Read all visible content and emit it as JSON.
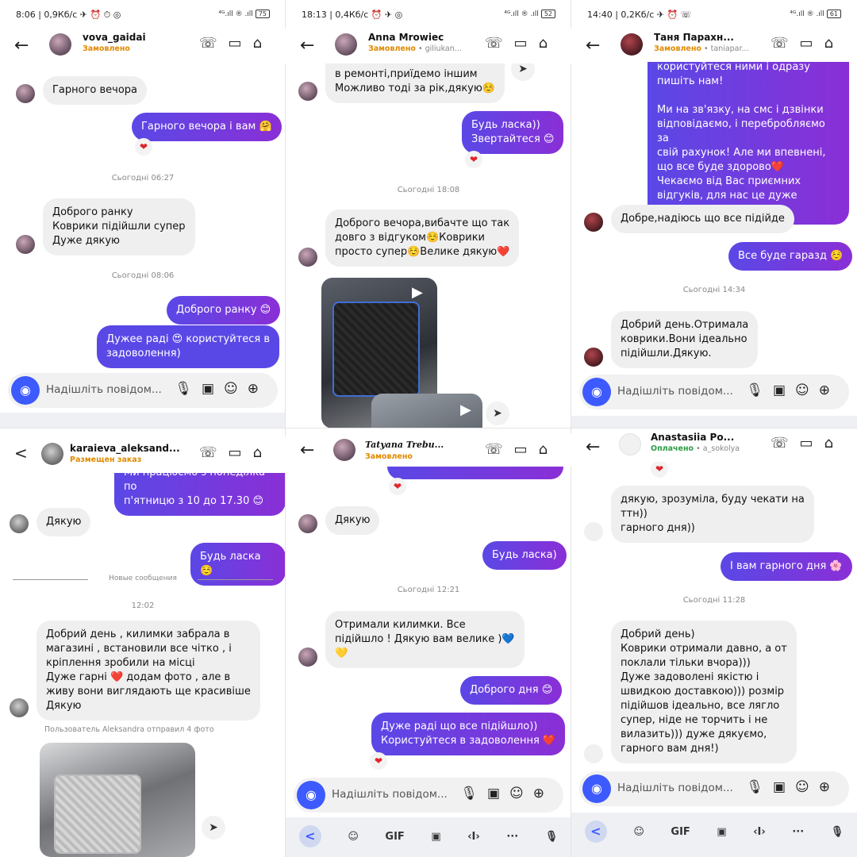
{
  "p0": {
    "status": {
      "left": "8:06 | 0,9Кб/с ✈ ⏰ ⏱ ◎",
      "right": "⁴ᴳ.ıll ® .ıll",
      "battery": "75"
    },
    "name": "vova_gaidai",
    "status_label": "Замовлено",
    "sub": "",
    "messages": [
      {
        "text": "Гарного вечора",
        "dir": "in"
      },
      {
        "text": "Гарного вечора і вам 🤗",
        "dir": "out"
      },
      {
        "text": "Доброго ранку\nКоврики підійшли супер\nДуже дякую",
        "dir": "in"
      },
      {
        "text": "Доброго ранку 😊",
        "dir": "out"
      },
      {
        "text": "Дужее раді 😍 користуйтеся в\nзадоволення)",
        "dir": "out"
      }
    ],
    "times": [
      "Сьогодні 06:27",
      "Сьогодні 08:06"
    ],
    "placeholder": "Надішліть повідом..."
  },
  "p1": {
    "status": {
      "left": "18:13 | 0,4Кб/с ⏰ ✈ ◎",
      "right": "⁴ᴳ.ıll ® .ıll",
      "battery": "52"
    },
    "name": "Anna Mrowiec",
    "status_label": "Замовлено",
    "sub": " • giliukan...",
    "messages": [
      {
        "text": "в ремонті,приїдемо іншим\nМожливо тоді за рік,дякую☺️",
        "dir": "in"
      },
      {
        "text": "Будь ласка))\nЗвертайтеся 😊",
        "dir": "out"
      },
      {
        "text": "Доброго вечора,вибачте що так\nдовго з відгуком☺️Коврики\nпросто супер☺️Велике дякую❤️",
        "dir": "in"
      }
    ],
    "times": [
      "Сьогодні 18:08"
    ]
  },
  "p2": {
    "status": {
      "left": "14:40 | 0,2Кб/с ✈ ⏰ ☏",
      "right": "⁴ᴳ.ıll ® .ıll",
      "battery": "61"
    },
    "name": "Таня Парахн...",
    "status_label": "Замовлено",
    "sub": " • taniapar...",
    "messages": [
      {
        "text": "користуйтеся ними і одразу\nпишіть нам!\n\nМи на зв'язку, на смс і дзвінки\nвідповідаємо, і перебробляємо за\nсвій рахунок! Але ми впевнені,\nщо все буде здорово❤️\nЧекаємо від Вас приємних\nвідгуків, для нас це дуже цінно)))",
        "dir": "out"
      },
      {
        "text": "Добре,надіюсь що все підійде",
        "dir": "in"
      },
      {
        "text": "Все буде гаразд ☺️",
        "dir": "out"
      },
      {
        "text": "Добрий день.Отримала\nковрики.Вони ідеально\nпідійшли.Дякую.",
        "dir": "in"
      }
    ],
    "times": [
      "Сьогодні 14:34"
    ],
    "placeholder": "Надішліть повідом..."
  },
  "p3": {
    "name": "karaieva_aleksand...",
    "status_label": "Размещен заказ",
    "messages": [
      {
        "text": "Ми працюємо з понеділка по\nп'ятницю з 10 до 17.30 😊",
        "dir": "out"
      },
      {
        "text": "Дякую",
        "dir": "in"
      },
      {
        "text": "Будь ласка ☺️",
        "dir": "out"
      },
      {
        "text": "Добрий день , килимки забрала в\nмагазині , встановили все чітко , і\nкріплення зробили на місці\nДуже гарні ❤️ додам фото , але в\nживу вони виглядають ще красивіше\nДякую",
        "dir": "in"
      }
    ],
    "divider": "Новые сообщения",
    "time": "12:02",
    "note": "Пользователь Aleksandra отправил 4 фото"
  },
  "p4": {
    "name": "Tatyana Trebu...",
    "status_label": "Замовлено",
    "messages": [
      {
        "text": "Дякую",
        "dir": "in"
      },
      {
        "text": "Будь ласка)",
        "dir": "out"
      },
      {
        "text": "Отримали килимки.  Все\nпідійшло ! Дякую вам велике )💙\n💛",
        "dir": "in"
      },
      {
        "text": "Доброго дня 😊",
        "dir": "out"
      },
      {
        "text": "Дуже раді що все підійшло))\nКористуйтеся в задоволення ❤️",
        "dir": "out"
      }
    ],
    "times": [
      "Сьогодні 12:21"
    ],
    "placeholder": "Надішліть повідом..."
  },
  "p5": {
    "name": "Anastasiia Po...",
    "status_label": "Оплачено",
    "sub": " • a_sokolya",
    "messages": [
      {
        "text": "дякую, зрозуміла, буду чекати на\nттн))\nгарного дня))",
        "dir": "in"
      },
      {
        "text": "І вам гарного дня 🌸",
        "dir": "out"
      },
      {
        "text": "Добрий день)\nКоврики отримали давно, а от\nпоклали тільки вчора)))\nДуже задоволені якістю і\nшвидкою доставкою))) розмір\nпідійшов ідеально, все лягло\nсупер, ніде не торчить і не\nвилазить))) дуже дякуємо,\nгарного вам дня!)",
        "dir": "in"
      }
    ],
    "times": [
      "Сьогодні 11:28"
    ],
    "placeholder": "Надішліть повідом..."
  },
  "icons": {
    "back": "←",
    "back_chevron": "<",
    "phone": "☏",
    "video": "▭",
    "tag": "⌂",
    "camera": "◉",
    "mic": "🎙",
    "gallery": "▣",
    "sticker": "☺",
    "plus": "⊕",
    "heart": "❤",
    "play": "▶",
    "send": "➤"
  },
  "keyboard": {
    "gif": "GIF",
    "more": "···",
    "cursor": "‹I›"
  },
  "colors": {
    "accent": "#5a48e6",
    "accent2": "#8a2fd6",
    "order": "#e08a00",
    "paid": "#2e9b46",
    "camera": "#3d5afe"
  }
}
